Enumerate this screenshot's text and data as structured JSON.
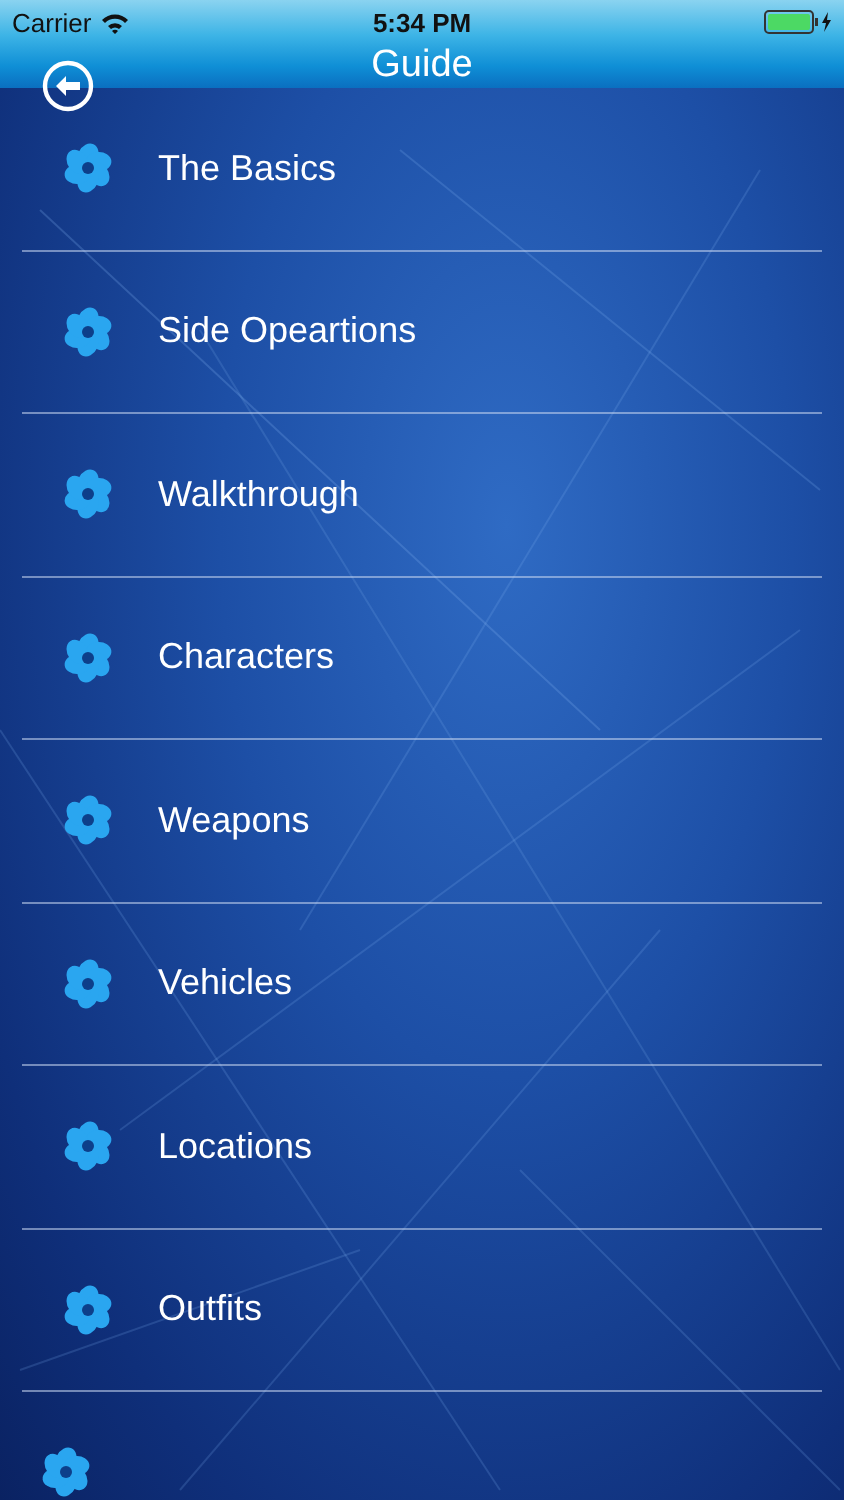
{
  "status_bar": {
    "carrier": "Carrier",
    "time": "5:34 PM"
  },
  "nav_bar": {
    "title": "Guide"
  },
  "menu": [
    {
      "label": "The Basics"
    },
    {
      "label": "Side Opeartions"
    },
    {
      "label": "Walkthrough"
    },
    {
      "label": "Characters"
    },
    {
      "label": "Weapons"
    },
    {
      "label": "Vehicles"
    },
    {
      "label": "Locations"
    },
    {
      "label": "Outfits"
    }
  ]
}
